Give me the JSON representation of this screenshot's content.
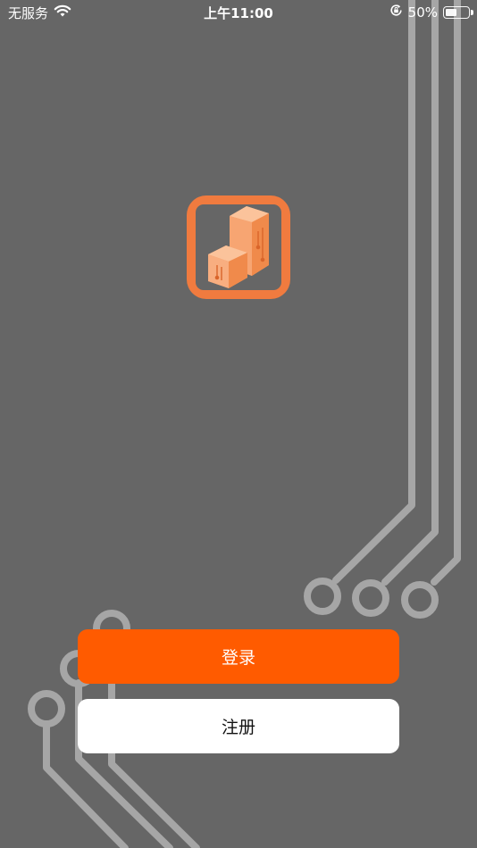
{
  "status_bar": {
    "carrier": "无服务",
    "time": "上午11:00",
    "battery_percent": "50%",
    "battery_level": 0.5
  },
  "actions": {
    "login_label": "登录",
    "register_label": "注册"
  },
  "colors": {
    "background": "#666666",
    "primary": "#ff5b00",
    "logo_frame": "#f07b3f",
    "logo_fill": "#f7a572",
    "circuit_line": "#a6a6a6"
  },
  "icons": {
    "wifi": "wifi-icon",
    "orientation_lock": "orientation-lock-icon",
    "battery": "battery-icon",
    "logo": "boxes-logo-icon"
  }
}
